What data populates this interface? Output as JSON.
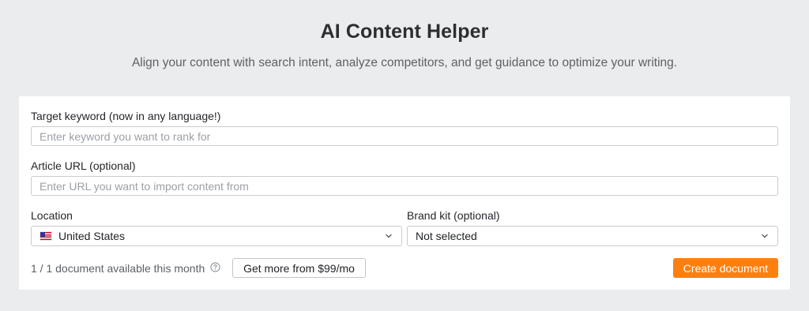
{
  "header": {
    "title": "AI Content Helper",
    "subtitle": "Align your content with search intent, analyze competitors, and get guidance to optimize your writing."
  },
  "form": {
    "keyword": {
      "label": "Target keyword (now in any language!)",
      "value": "",
      "placeholder": "Enter keyword you want to rank for"
    },
    "article_url": {
      "label": "Article URL (optional)",
      "value": "",
      "placeholder": "Enter URL you want to import content from"
    },
    "location": {
      "label": "Location",
      "value": "United States",
      "icon": "us-flag-icon"
    },
    "brand_kit": {
      "label": "Brand kit (optional)",
      "value": "Not selected"
    }
  },
  "footer": {
    "usage_text": "1 / 1 document available this month",
    "help_icon": "question-circle-icon",
    "upgrade_label": "Get more from $99/mo",
    "create_label": "Create document"
  },
  "colors": {
    "page_background": "#ebecee",
    "card_background": "#ffffff",
    "accent": "#ff7f0e",
    "input_border": "#c9ccd1",
    "placeholder": "#9ba0a6"
  }
}
